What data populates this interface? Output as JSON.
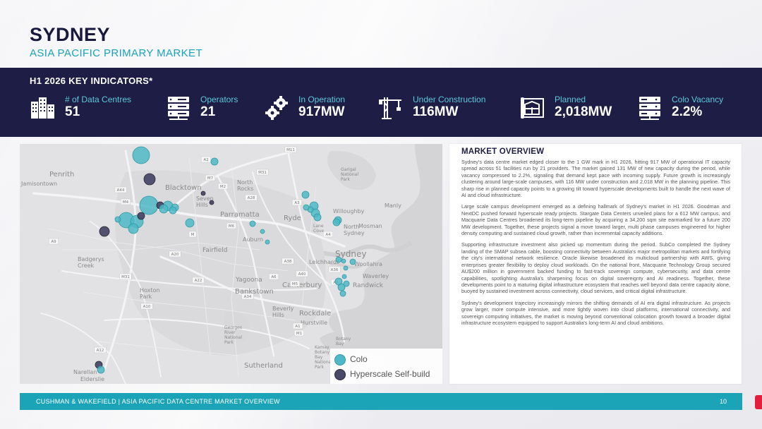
{
  "header": {
    "title": "SYDNEY",
    "subtitle": "ASIA PACIFIC PRIMARY MARKET"
  },
  "kpis": {
    "heading": "H1 2026 KEY INDICATORS*",
    "items": [
      {
        "label": "# of Data Centres",
        "value": "51",
        "icon": "buildings-icon"
      },
      {
        "label": "Operators",
        "value": "21",
        "icon": "server-icon"
      },
      {
        "label": "In Operation",
        "value": "917MW",
        "icon": "gears-icon"
      },
      {
        "label": "Under Construction",
        "value": "116MW",
        "icon": "crane-icon"
      },
      {
        "label": "Planned",
        "value": "2,018MW",
        "icon": "blueprint-icon"
      },
      {
        "label": "Colo Vacancy",
        "value": "2.2%",
        "icon": "server-rack-icon"
      }
    ]
  },
  "map": {
    "places": [
      {
        "name": "Penrith"
      },
      {
        "name": "Jamisontown"
      },
      {
        "name": "Blacktown"
      },
      {
        "name": "North Rocks"
      },
      {
        "name": "Seven Hills"
      },
      {
        "name": "Parramatta"
      },
      {
        "name": "Ryde"
      },
      {
        "name": "Willoughby"
      },
      {
        "name": "North Sydney"
      },
      {
        "name": "Mosman"
      },
      {
        "name": "Manly"
      },
      {
        "name": "Auburn"
      },
      {
        "name": "Fairfield"
      },
      {
        "name": "Sydney"
      },
      {
        "name": "Leichhardt"
      },
      {
        "name": "Woollahra"
      },
      {
        "name": "Waverley"
      },
      {
        "name": "Randwick"
      },
      {
        "name": "Badgerys Creek"
      },
      {
        "name": "Yagoona"
      },
      {
        "name": "Canterbury"
      },
      {
        "name": "Hoxton Park"
      },
      {
        "name": "Bankstown"
      },
      {
        "name": "Beverly Hills"
      },
      {
        "name": "Rockdale"
      },
      {
        "name": "Hurstville"
      },
      {
        "name": "Georges River National Park"
      },
      {
        "name": "Sutherland"
      },
      {
        "name": "Narellan"
      },
      {
        "name": "Elderslie"
      },
      {
        "name": "Lane Cove"
      },
      {
        "name": "Garigal National Park"
      },
      {
        "name": "Botany Bay"
      },
      {
        "name": "Kamay Botany Bay National Park"
      }
    ],
    "roads": [
      "M11",
      "M4",
      "A2",
      "M2",
      "M7",
      "A44",
      "A28",
      "M31",
      "M5",
      "A6",
      "A3",
      "A4",
      "A22",
      "A34",
      "A36",
      "A9",
      "M",
      "M6",
      "A1",
      "A8",
      "A12",
      "A10",
      "M31",
      "M1",
      "A38",
      "A40",
      "A20"
    ],
    "colo_color": "#4fb8c6",
    "hyperscale_color": "#4a4a68",
    "legend": {
      "colo": "Colo",
      "hyperscale": "Hyperscale Self-build"
    }
  },
  "overview": {
    "heading": "MARKET OVERVIEW",
    "paragraphs": [
      "Sydney's data centre market edged closer to the 1 GW mark in H1 2026, hitting 917 MW of operational IT capacity spread across 51 facilities run by 21 providers. The market gained 131 MW of new capacity during the period, while vacancy compressed to 2.2%, signaling that demand kept pace with incoming supply. Future growth is increasingly clustering around large-scale campuses, with 116 MW under construction and 2,018 MW in the planning pipeline. This sharp rise in planned capacity points to a growing tilt toward hyperscale developments built to handle the next wave of AI and cloud infrastructure.",
      "Large scale campus development emerged as a defining hallmark of Sydney's market in H1 2026. Goodman and NextDC pushed forward hyperscale ready projects. Stargate Data Centers unveiled plans for a 612 MW campus, and Macquarie Data Centres broadened its long-term pipeline by acquiring a 34,200 sqm site earmarked for a future 200 MW development. Together, these projects signal a move toward larger, multi phase campuses engineered for higher density computing and sustained cloud growth, rather than incremental capacity additions.",
      "Supporting infrastructure investment also picked up momentum during the period. SubCo completed the Sydney landing of the SMAP subsea cable, boosting connectivity between Australia's major metropolitan markets and fortifying the city's international network resilience. Oracle likewise broadened its multicloud partnership with AWS, giving enterprises greater flexibility to deploy cloud workloads. On the national front, Macquarie Technology Group secured AU$200 million in government backed funding to fast-track sovereign compute, cybersecurity, and data centre capabilities, spotlighting Australia's sharpening focus on digital sovereignty and AI readiness. Together, these developments point to a maturing digital infrastructure ecosystem that reaches well beyond data centre capacity alone, buoyed by sustained investment across connectivity, cloud services, and critical digital infrastructure.",
      "Sydney's development trajectory increasingly mirrors the shifting demands of AI era digital infrastructure. As projects grow larger, more compute intensive, and more tightly woven into cloud platforms, international connectivity, and sovereign computing initiatives, the market is moving beyond conventional colocation growth toward a broader digital infrastructure ecosystem equipped to support Australia's long-term AI and cloud ambitions."
    ]
  },
  "footer": {
    "text": "CUSHMAN & WAKEFIELD  |  ASIA PACIFIC DATA CENTRE MARKET OVERVIEW",
    "page": "10"
  }
}
